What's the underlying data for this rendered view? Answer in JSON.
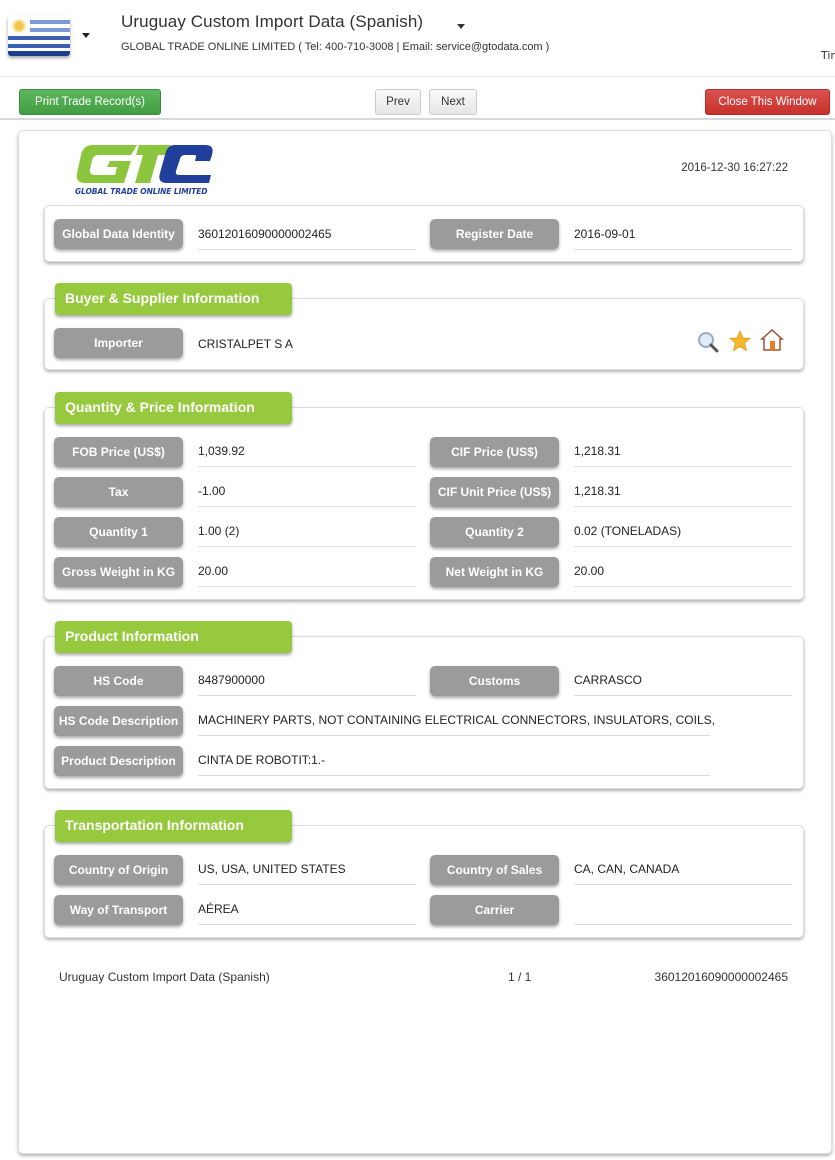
{
  "header": {
    "title": "Uruguay Custom Import Data (Spanish)",
    "subtitle": "GLOBAL TRADE ONLINE LIMITED ( Tel: 400-710-3008 | Email: service@gtodata.com )",
    "truncated_right_text": "Tir",
    "flag_icon": "uruguay-flag"
  },
  "toolbar": {
    "print_label": "Print Trade Record(s)",
    "prev_label": "Prev",
    "next_label": "Next",
    "close_label": "Close This Window"
  },
  "document": {
    "logo_text": "GLOBAL TRADE  ONLINE LIMITED",
    "timestamp": "2016-12-30 16:27:22",
    "identity": {
      "global_data_identity_label": "Global Data Identity",
      "global_data_identity": "36012016090000002465",
      "register_date_label": "Register Date",
      "register_date": "2016-09-01"
    },
    "buyer_supplier": {
      "title": "Buyer & Supplier Information",
      "importer_label": "Importer",
      "importer": "CRISTALPET S A",
      "icons": [
        "search-icon",
        "star-icon",
        "home-icon"
      ]
    },
    "quantity_price": {
      "title": "Quantity & Price Information",
      "fob_price_label": "FOB Price (US$)",
      "fob_price": "1,039.92",
      "cif_price_label": "CIF Price (US$)",
      "cif_price": "1,218.31",
      "tax_label": "Tax",
      "tax": "-1.00",
      "cif_unit_price_label": "CIF Unit Price (US$)",
      "cif_unit_price": "1,218.31",
      "quantity1_label": "Quantity 1",
      "quantity1": "1.00 (2)",
      "quantity2_label": "Quantity 2",
      "quantity2": "0.02 (TONELADAS)",
      "gross_weight_label": "Gross Weight in KG",
      "gross_weight": "20.00",
      "net_weight_label": "Net Weight in KG",
      "net_weight": "20.00"
    },
    "product": {
      "title": "Product Information",
      "hs_code_label": "HS Code",
      "hs_code": "8487900000",
      "customs_label": "Customs",
      "customs": "CARRASCO",
      "hs_desc_label": "HS Code Description",
      "hs_desc": "MACHINERY PARTS, NOT CONTAINING ELECTRICAL CONNECTORS, INSULATORS, COILS,",
      "product_desc_label": "Product Description",
      "product_desc": "CINTA DE ROBOTIT:1.-"
    },
    "transportation": {
      "title": "Transportation Information",
      "origin_label": "Country of Origin",
      "origin": "US, USA, UNITED STATES",
      "sales_label": "Country of Sales",
      "sales": "CA, CAN, CANADA",
      "transport_label": "Way of Transport",
      "transport": "AÉREA",
      "carrier_label": "Carrier",
      "carrier": ""
    },
    "footer": {
      "source": "Uruguay Custom Import Data (Spanish)",
      "pagination": "1 / 1",
      "record_id": "36012016090000002465"
    }
  },
  "colors": {
    "section_header": "#96c93d",
    "label_bg": "#9b9b9b",
    "print_button": "#5cb85c",
    "close_button": "#d9534f",
    "logo_green": "#8cc63f",
    "logo_blue": "#1f3f9a"
  }
}
